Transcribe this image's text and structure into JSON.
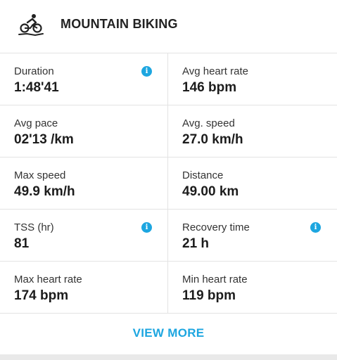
{
  "header": {
    "icon": "mountain-biking-icon",
    "title": "MOUNTAIN BIKING"
  },
  "stats": [
    {
      "left": {
        "label": "Duration",
        "value": "1:48'41",
        "info": true
      },
      "right": {
        "label": "Avg heart rate",
        "value": "146 bpm",
        "info": false
      }
    },
    {
      "left": {
        "label": "Avg pace",
        "value": "02'13 /km",
        "info": false
      },
      "right": {
        "label": "Avg. speed",
        "value": "27.0 km/h",
        "info": false
      }
    },
    {
      "left": {
        "label": "Max speed",
        "value": "49.9 km/h",
        "info": false
      },
      "right": {
        "label": "Distance",
        "value": "49.00 km",
        "info": false
      }
    },
    {
      "left": {
        "label": "TSS (hr)",
        "value": "81",
        "info": true
      },
      "right": {
        "label": "Recovery time",
        "value": "21 h",
        "info": true
      }
    },
    {
      "left": {
        "label": "Max heart rate",
        "value": "174 bpm",
        "info": false
      },
      "right": {
        "label": "Min heart rate",
        "value": "119 bpm",
        "info": false
      }
    }
  ],
  "footer": {
    "view_more_label": "VIEW MORE"
  },
  "colors": {
    "accent": "#1da6e0",
    "text": "#1c1c1c",
    "divider": "#e3e3e3"
  }
}
